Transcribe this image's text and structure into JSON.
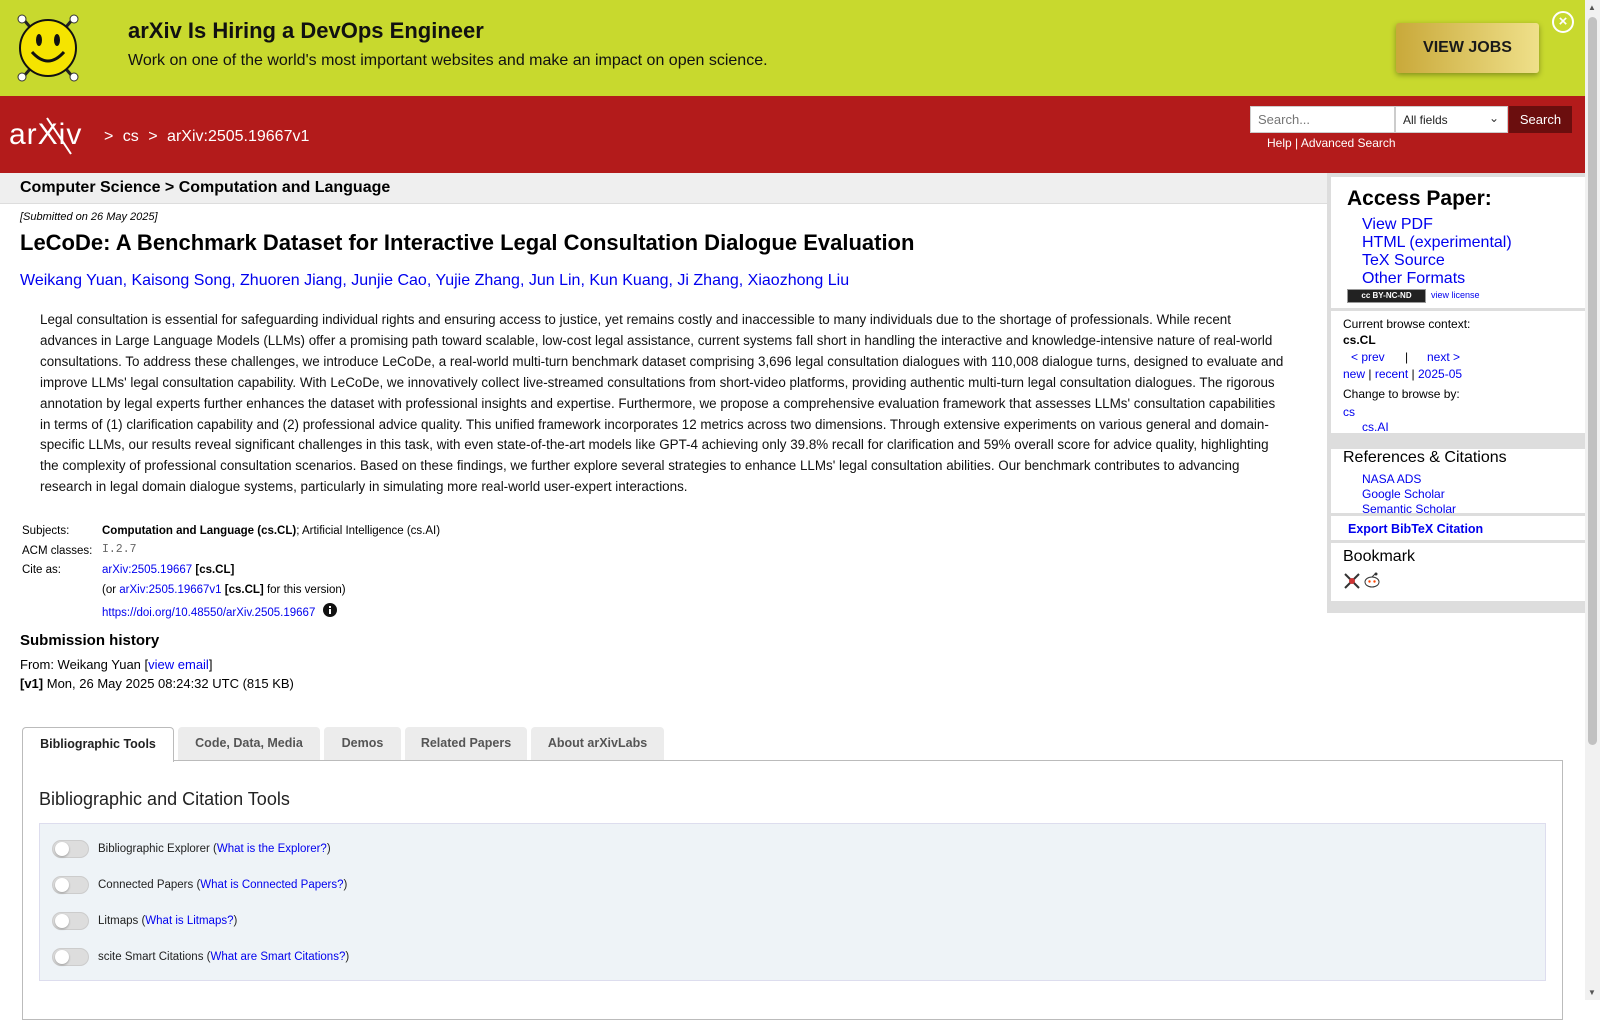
{
  "banner": {
    "title": "arXiv Is Hiring a DevOps Engineer",
    "subtitle": "Work on one of the world's most important websites and make an impact on open science.",
    "button": "VIEW JOBS",
    "close_icon": "×"
  },
  "header": {
    "logo_text": "arXiv",
    "breadcrumb": [
      ">",
      "cs",
      ">",
      "arXiv:2505.19667v1"
    ],
    "search_placeholder": "Search...",
    "search_field": "All fields",
    "search_button": "Search",
    "help_link": "Help",
    "separator": "|",
    "advanced_link": "Advanced Search"
  },
  "subject_bar": "Computer Science > Computation and Language",
  "paper": {
    "submitted": "[Submitted on 26 May 2025]",
    "title": "LeCoDe: A Benchmark Dataset for Interactive Legal Consultation Dialogue Evaluation",
    "authors": [
      "Weikang Yuan",
      "Kaisong Song",
      "Zhuoren Jiang",
      "Junjie Cao",
      "Yujie Zhang",
      "Jun Lin",
      "Kun Kuang",
      "Ji Zhang",
      "Xiaozhong Liu"
    ],
    "abstract": "Legal consultation is essential for safeguarding individual rights and ensuring access to justice, yet remains costly and inaccessible to many individuals due to the shortage of professionals. While recent advances in Large Language Models (LLMs) offer a promising path toward scalable, low-cost legal assistance, current systems fall short in handling the interactive and knowledge-intensive nature of real-world consultations. To address these challenges, we introduce LeCoDe, a real-world multi-turn benchmark dataset comprising 3,696 legal consultation dialogues with 110,008 dialogue turns, designed to evaluate and improve LLMs' legal consultation capability. With LeCoDe, we innovatively collect live-streamed consultations from short-video platforms, providing authentic multi-turn legal consultation dialogues. The rigorous annotation by legal experts further enhances the dataset with professional insights and expertise. Furthermore, we propose a comprehensive evaluation framework that assesses LLMs' consultation capabilities in terms of (1) clarification capability and (2) professional advice quality. This unified framework incorporates 12 metrics across two dimensions. Through extensive experiments on various general and domain-specific LLMs, our results reveal significant challenges in this task, with even state-of-the-art models like GPT-4 achieving only 39.8% recall for clarification and 59% overall score for advice quality, highlighting the complexity of professional consultation scenarios. Based on these findings, we further explore several strategies to enhance LLMs' legal consultation abilities. Our benchmark contributes to advancing research in legal domain dialogue systems, particularly in simulating more real-world user-expert interactions.",
    "subjects_label": "Subjects:",
    "subjects_primary": "Computation and Language (cs.CL)",
    "subjects_rest": "; Artificial Intelligence (cs.AI)",
    "acm_label": "ACM classes:",
    "acm_value": "I.2.7",
    "cite_label": "Cite as:",
    "cite_id": "arXiv:2505.19667",
    "cite_tag": "[cs.CL]",
    "cite_or": "(or",
    "cite_version": "arXiv:2505.19667v1",
    "cite_version_tag": "[cs.CL]",
    "cite_version_suffix": "for this version)",
    "doi": "https://doi.org/10.48550/arXiv.2505.19667"
  },
  "history": {
    "title": "Submission history",
    "from": "From: Weikang Yuan [",
    "view_email": "view email",
    "close_bracket": "]",
    "v1_label": "[v1]",
    "v1_text": "Mon, 26 May 2025 08:24:32 UTC (815 KB)"
  },
  "sidebar": {
    "access_title": "Access Paper:",
    "links": [
      "View PDF",
      "HTML (experimental)",
      "TeX Source",
      "Other Formats"
    ],
    "license_badge": "cc BY-NC-ND",
    "view_license": "view license",
    "context_label": "Current browse context:",
    "context_value": "cs.CL",
    "prev": "< prev",
    "pipe": "|",
    "next": "next >",
    "new": "new",
    "recent": "recent",
    "month": "2025-05",
    "change_label": "Change to browse by:",
    "browse_cs": "cs",
    "browse_ai": "cs.AI",
    "refs_title": "References & Citations",
    "refs": [
      "NASA ADS",
      "Google Scholar",
      "Semantic Scholar"
    ],
    "export": "Export BibTeX Citation",
    "bookmark_title": "Bookmark"
  },
  "tabs": [
    "Bibliographic Tools",
    "Code, Data, Media",
    "Demos",
    "Related Papers",
    "About arXivLabs"
  ],
  "tools": {
    "title": "Bibliographic and Citation Tools",
    "rows": [
      {
        "label": "Bibliographic Explorer (",
        "link": "What is the Explorer?",
        "end": ")"
      },
      {
        "label": "Connected Papers (",
        "link": "What is Connected Papers?",
        "end": ")"
      },
      {
        "label": "Litmaps (",
        "link": "What is Litmaps?",
        "end": ")"
      },
      {
        "label": "scite Smart Citations (",
        "link": "What are Smart Citations?",
        "end": ")"
      }
    ]
  },
  "colors": {
    "banner": "#c8d92e",
    "header": "#b31b1b",
    "link": "#0000ee"
  }
}
